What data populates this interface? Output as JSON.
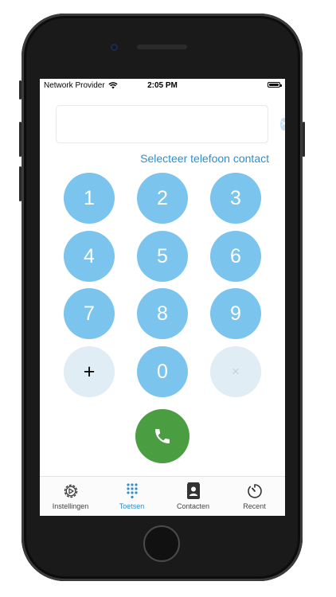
{
  "status_bar": {
    "carrier": "Network Provider",
    "time": "2:05 PM"
  },
  "dialer": {
    "number_value": "",
    "clear_symbol": "✕",
    "select_contact_label": "Selecteer telefoon contact",
    "keys": [
      "1",
      "2",
      "3",
      "4",
      "5",
      "6",
      "7",
      "8",
      "9",
      "+",
      "0",
      "×"
    ],
    "call_icon": "phone-icon"
  },
  "tabs": [
    {
      "label": "Instellingen",
      "icon": "settings-gear-icon",
      "active": false
    },
    {
      "label": "Toetsen",
      "icon": "keypad-icon",
      "active": true
    },
    {
      "label": "Contacten",
      "icon": "contacts-icon",
      "active": false
    },
    {
      "label": "Recent",
      "icon": "recent-clock-icon",
      "active": false
    }
  ],
  "colors": {
    "key_blue": "#7ac4ee",
    "key_light": "#e0edf4",
    "accent": "#2d8fce",
    "call_green": "#4a9d40"
  }
}
